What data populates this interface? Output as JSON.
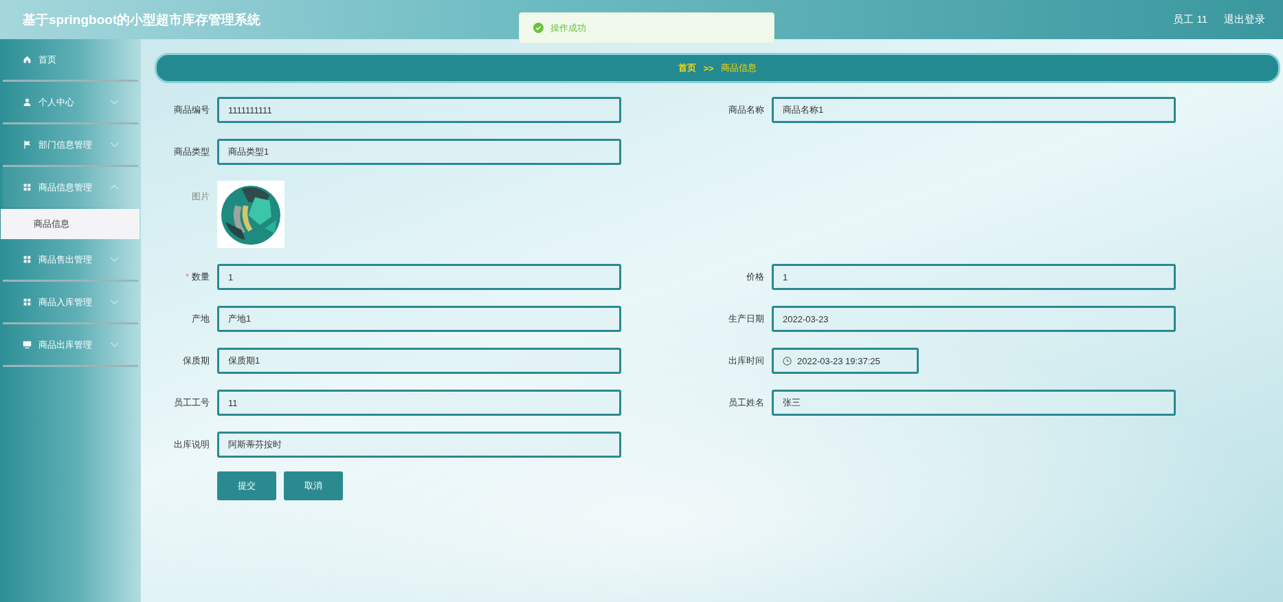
{
  "header": {
    "title": "基于springboot的小型超市库存管理系统",
    "user": "员工 11",
    "logout": "退出登录"
  },
  "toast": {
    "kind": "success",
    "message": "操作成功"
  },
  "sidebar": {
    "items": [
      {
        "label": "首页"
      },
      {
        "label": "个人中心",
        "expanded": false
      },
      {
        "label": "部门信息管理",
        "expanded": false
      },
      {
        "label": "商品信息管理",
        "expanded": true,
        "children": [
          {
            "label": "商品信息",
            "selected": true
          }
        ]
      },
      {
        "label": "商品售出管理",
        "expanded": false
      },
      {
        "label": "商品入库管理",
        "expanded": false
      },
      {
        "label": "商品出库管理",
        "expanded": false
      }
    ]
  },
  "breadcrumb": {
    "items": [
      "首页",
      "商品信息"
    ],
    "separator": ">>"
  },
  "form": {
    "required_mark": "*",
    "rows": [
      [
        {
          "kind": "text",
          "label": "商品编号",
          "value": "1111111111",
          "required": false
        },
        {
          "kind": "text",
          "label": "商品名称",
          "value": "商品名称1",
          "required": false
        }
      ],
      [
        {
          "kind": "text",
          "label": "商品类型",
          "value": "商品类型1",
          "required": false
        }
      ],
      [
        {
          "label": "图片"
        }
      ],
      [
        {
          "kind": "text",
          "label": "数量",
          "value": "1",
          "required": true
        },
        {
          "kind": "text",
          "label": "价格",
          "value": "1",
          "required": false
        }
      ],
      [
        {
          "kind": "text",
          "label": "产地",
          "value": "产地1",
          "required": false
        },
        {
          "kind": "text",
          "label": "生产日期",
          "value": "2022-03-23",
          "required": false
        }
      ],
      [
        {
          "kind": "text",
          "label": "保质期",
          "value": "保质期1",
          "required": false
        },
        {
          "kind": "datetime",
          "label": "出库时间",
          "value": "2022-03-23 19:37:25",
          "required": false
        }
      ],
      [
        {
          "kind": "text",
          "label": "员工工号",
          "value": "11",
          "required": false
        },
        {
          "kind": "text",
          "label": "员工姓名",
          "value": "张三",
          "required": false
        }
      ],
      [
        {
          "kind": "text",
          "label": "出库说明",
          "value": "阿斯蒂芬按时",
          "required": false
        }
      ]
    ],
    "buttons": [
      "提交",
      "取消"
    ]
  }
}
